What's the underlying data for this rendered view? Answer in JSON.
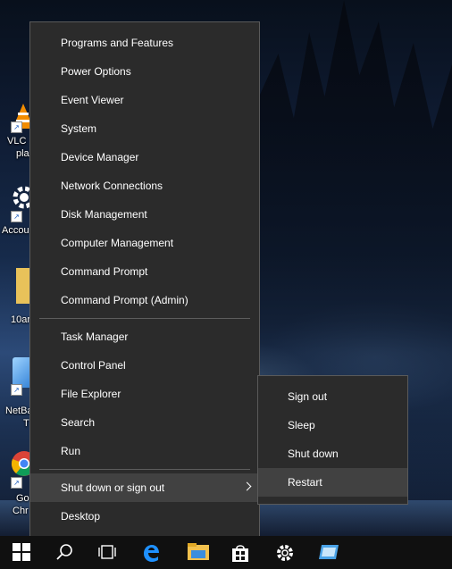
{
  "desktop": {
    "icons": [
      {
        "name": "vlc",
        "label_line1": "VLC",
        "label_line2": "pla"
      },
      {
        "name": "accounts",
        "label_line1": "Accou"
      },
      {
        "name": "folder",
        "label_line1": "10ar"
      },
      {
        "name": "netbeans",
        "label_line1": "NetBa",
        "label_line2": "T"
      },
      {
        "name": "chrome",
        "label_line1": "Go",
        "label_line2": "Chr"
      }
    ]
  },
  "menu": {
    "group1": [
      "Programs and Features",
      "Power Options",
      "Event Viewer",
      "System",
      "Device Manager",
      "Network Connections",
      "Disk Management",
      "Computer Management",
      "Command Prompt",
      "Command Prompt (Admin)"
    ],
    "group2": [
      "Task Manager",
      "Control Panel",
      "File Explorer",
      "Search",
      "Run"
    ],
    "shutdown_label": "Shut down or sign out",
    "desktop_label": "Desktop"
  },
  "submenu": {
    "items": [
      "Sign out",
      "Sleep",
      "Shut down",
      "Restart"
    ]
  },
  "taskbar": {
    "buttons": [
      "windows-start-icon",
      "search-icon",
      "task-view-icon",
      "edge-icon",
      "file-explorer-icon",
      "store-icon",
      "settings-gear-icon",
      "window-app-icon"
    ],
    "accent": "#1e90ff"
  }
}
